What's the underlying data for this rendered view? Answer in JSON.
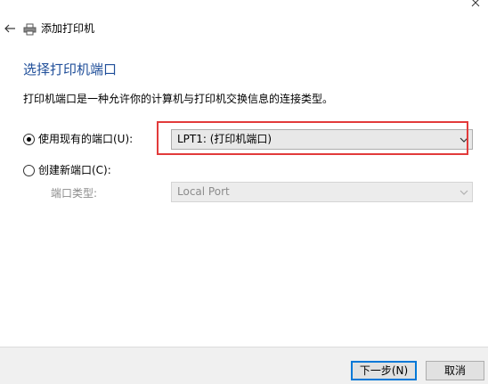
{
  "window": {
    "close_icon": "close-x-icon",
    "back_icon": "back-arrow-icon",
    "printer_icon": "printer-icon",
    "title": "添加打印机"
  },
  "page": {
    "heading": "选择打印机端口",
    "description": "打印机端口是一种允许你的计算机与打印机交换信息的连接类型。"
  },
  "options": {
    "use_existing": {
      "label": "使用现有的端口(U):",
      "selected": true,
      "value": "LPT1: (打印机端口)"
    },
    "create_new": {
      "label": "创建新端口(C):",
      "selected": false,
      "port_type_label": "端口类型:",
      "port_type_value": "Local Port"
    }
  },
  "footer": {
    "next_label": "下一步(N)",
    "cancel_label": "取消"
  },
  "colors": {
    "heading": "#1f4e99",
    "highlight": "#e23b3b",
    "primary_border": "#0078d7"
  }
}
